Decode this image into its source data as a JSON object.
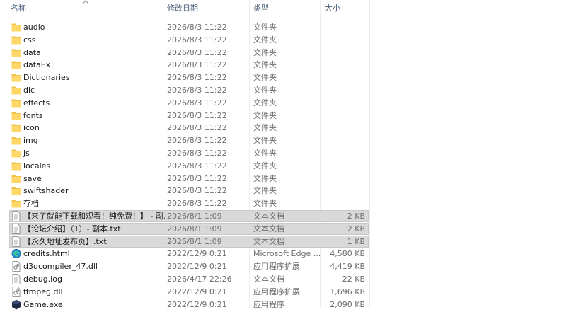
{
  "columns": {
    "name": "名称",
    "modified": "修改日期",
    "type": "类型",
    "size": "大小"
  },
  "files": [
    {
      "name": "audio",
      "date": "2026/8/3 11:22",
      "type": "文件夹",
      "size": "",
      "icon": "folder-icon",
      "selected": false
    },
    {
      "name": "css",
      "date": "2026/8/3 11:22",
      "type": "文件夹",
      "size": "",
      "icon": "folder-icon",
      "selected": false
    },
    {
      "name": "data",
      "date": "2026/8/3 11:22",
      "type": "文件夹",
      "size": "",
      "icon": "folder-icon",
      "selected": false
    },
    {
      "name": "dataEx",
      "date": "2026/8/3 11:22",
      "type": "文件夹",
      "size": "",
      "icon": "folder-icon",
      "selected": false
    },
    {
      "name": "Dictionaries",
      "date": "2026/8/3 11:22",
      "type": "文件夹",
      "size": "",
      "icon": "folder-icon",
      "selected": false
    },
    {
      "name": "dlc",
      "date": "2026/8/3 11:22",
      "type": "文件夹",
      "size": "",
      "icon": "folder-icon",
      "selected": false
    },
    {
      "name": "effects",
      "date": "2026/8/3 11:22",
      "type": "文件夹",
      "size": "",
      "icon": "folder-icon",
      "selected": false
    },
    {
      "name": "fonts",
      "date": "2026/8/3 11:22",
      "type": "文件夹",
      "size": "",
      "icon": "folder-icon",
      "selected": false
    },
    {
      "name": "icon",
      "date": "2026/8/3 11:22",
      "type": "文件夹",
      "size": "",
      "icon": "folder-icon",
      "selected": false
    },
    {
      "name": "img",
      "date": "2026/8/3 11:22",
      "type": "文件夹",
      "size": "",
      "icon": "folder-icon",
      "selected": false
    },
    {
      "name": "js",
      "date": "2026/8/3 11:22",
      "type": "文件夹",
      "size": "",
      "icon": "folder-icon",
      "selected": false
    },
    {
      "name": "locales",
      "date": "2026/8/3 11:22",
      "type": "文件夹",
      "size": "",
      "icon": "folder-icon",
      "selected": false
    },
    {
      "name": "save",
      "date": "2026/8/3 11:22",
      "type": "文件夹",
      "size": "",
      "icon": "folder-icon",
      "selected": false
    },
    {
      "name": "swiftshader",
      "date": "2026/8/3 11:22",
      "type": "文件夹",
      "size": "",
      "icon": "folder-icon",
      "selected": false
    },
    {
      "name": "存档",
      "date": "2026/8/3 11:22",
      "type": "文件夹",
      "size": "",
      "icon": "folder-icon",
      "selected": false
    },
    {
      "name": "【来了就能下载和观看！纯免费！】 - 副...",
      "date": "2026/8/1 1:09",
      "type": "文本文档",
      "size": "2 KB",
      "icon": "text-file-icon",
      "selected": true
    },
    {
      "name": "【论坛介绍】（1）- 副本.txt",
      "date": "2026/8/1 1:09",
      "type": "文本文档",
      "size": "2 KB",
      "icon": "text-file-icon",
      "selected": true
    },
    {
      "name": "【永久地址发布页】.txt",
      "date": "2026/8/1 1:09",
      "type": "文本文档",
      "size": "1 KB",
      "icon": "text-file-icon",
      "selected": true
    },
    {
      "name": "credits.html",
      "date": "2022/12/9 0:21",
      "type": "Microsoft Edge ...",
      "size": "4,580 KB",
      "icon": "edge-icon",
      "selected": false
    },
    {
      "name": "d3dcompiler_47.dll",
      "date": "2022/12/9 0:21",
      "type": "应用程序扩展",
      "size": "4,419 KB",
      "icon": "dll-file-icon",
      "selected": false
    },
    {
      "name": "debug.log",
      "date": "2026/4/17 22:26",
      "type": "文本文档",
      "size": "22 KB",
      "icon": "text-file-icon",
      "selected": false
    },
    {
      "name": "ffmpeg.dll",
      "date": "2022/12/9 0:21",
      "type": "应用程序扩展",
      "size": "1,696 KB",
      "icon": "dll-file-icon",
      "selected": false
    },
    {
      "name": "Game.exe",
      "date": "2022/12/9 0:21",
      "type": "应用程序",
      "size": "2,090 KB",
      "icon": "exe-icon",
      "selected": false
    }
  ]
}
